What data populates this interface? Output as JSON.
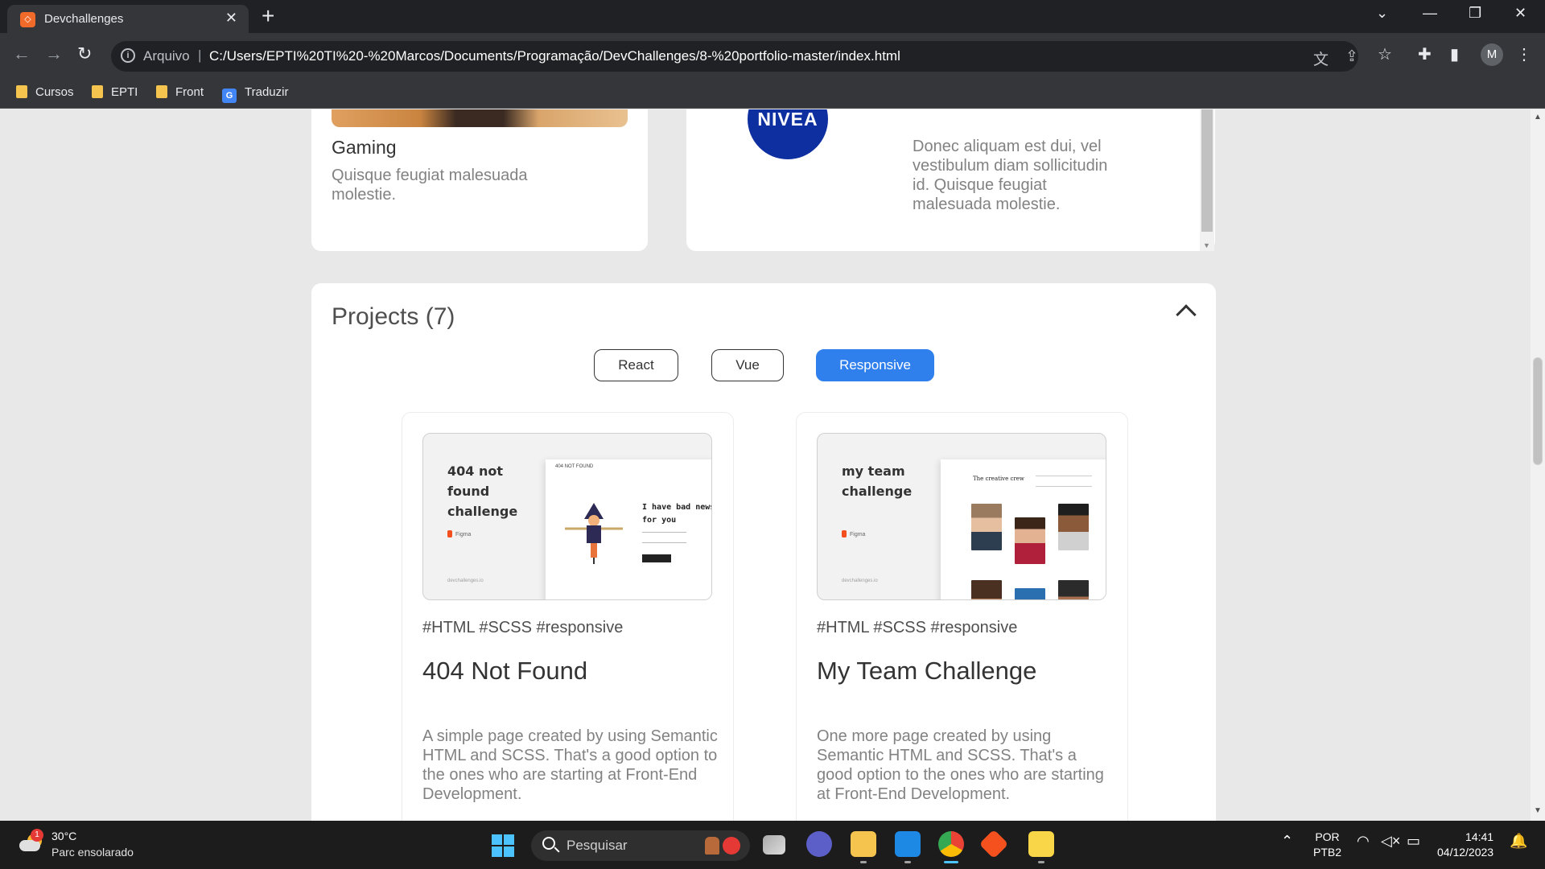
{
  "browser": {
    "tab_title": "Devchallenges",
    "tab_close": "✕",
    "new_tab": "+",
    "scheme_label": "Arquivo",
    "separator": "|",
    "url": "C:/Users/EPTI%20TI%20-%20Marcos/Documents/Programação/DevChallenges/8-%20portfolio-master/index.html",
    "profile_initial": "M",
    "bookmarks": [
      "Cursos",
      "EPTI",
      "Front",
      "Traduzir"
    ]
  },
  "page": {
    "hobby_card": {
      "title": "Gaming",
      "description": "Quisque feugiat malesuada molestie."
    },
    "experience_card": {
      "logo_text": "NIVEA",
      "description": "Donec aliquam est dui, vel vestibulum diam sollicitudin id. Quisque feugiat malesuada molestie."
    },
    "projects": {
      "heading": "Projects (7)",
      "filters": [
        {
          "label": "React",
          "active": false
        },
        {
          "label": "Vue",
          "active": false
        },
        {
          "label": "Responsive",
          "active": true
        }
      ],
      "cards": [
        {
          "thumb_title": "404 not found challenge",
          "thumb_figma": "Figma",
          "thumb_footer": "devchallenges.io",
          "thumb_header": "404 NOT FOUND",
          "thumb_bad_news": "I have bad news for you",
          "tags": "#HTML #SCSS #responsive",
          "title": "404 Not Found",
          "description": "A simple page created by using Semantic HTML and SCSS. That's a good option to the ones who are starting at Front-End Development."
        },
        {
          "thumb_title": "my team challenge",
          "thumb_figma": "Figma",
          "thumb_footer": "devchallenges.io",
          "thumb_header": "The creative crew",
          "tags": "#HTML #SCSS #responsive",
          "title": "My Team Challenge",
          "description": "One more page created by using Semantic HTML and SCSS. That's a good option to the ones who are starting at Front-End Development."
        }
      ]
    }
  },
  "taskbar": {
    "weather_temp": "30°C",
    "weather_desc": "Parc ensolarado",
    "weather_badge": "1",
    "search_placeholder": "Pesquisar",
    "lang_line1": "POR",
    "lang_line2": "PTB2",
    "time": "14:41",
    "date": "04/12/2023"
  },
  "colors": {
    "accent": "#2f80ed",
    "page_bg": "#e8e8e8",
    "chrome_dark": "#202124",
    "chrome_toolbar": "#35363a"
  },
  "icons": [
    "devchallenges-favicon",
    "back-arrow-icon",
    "forward-arrow-icon",
    "reload-icon",
    "info-icon",
    "translate-icon",
    "share-icon",
    "star-icon",
    "extensions-icon",
    "sidebar-icon",
    "menu-dots-icon",
    "chevron-up-icon",
    "windows-start-icon",
    "search-icon",
    "wifi-icon",
    "volume-muted-icon",
    "battery-icon",
    "notification-bell-icon"
  ]
}
